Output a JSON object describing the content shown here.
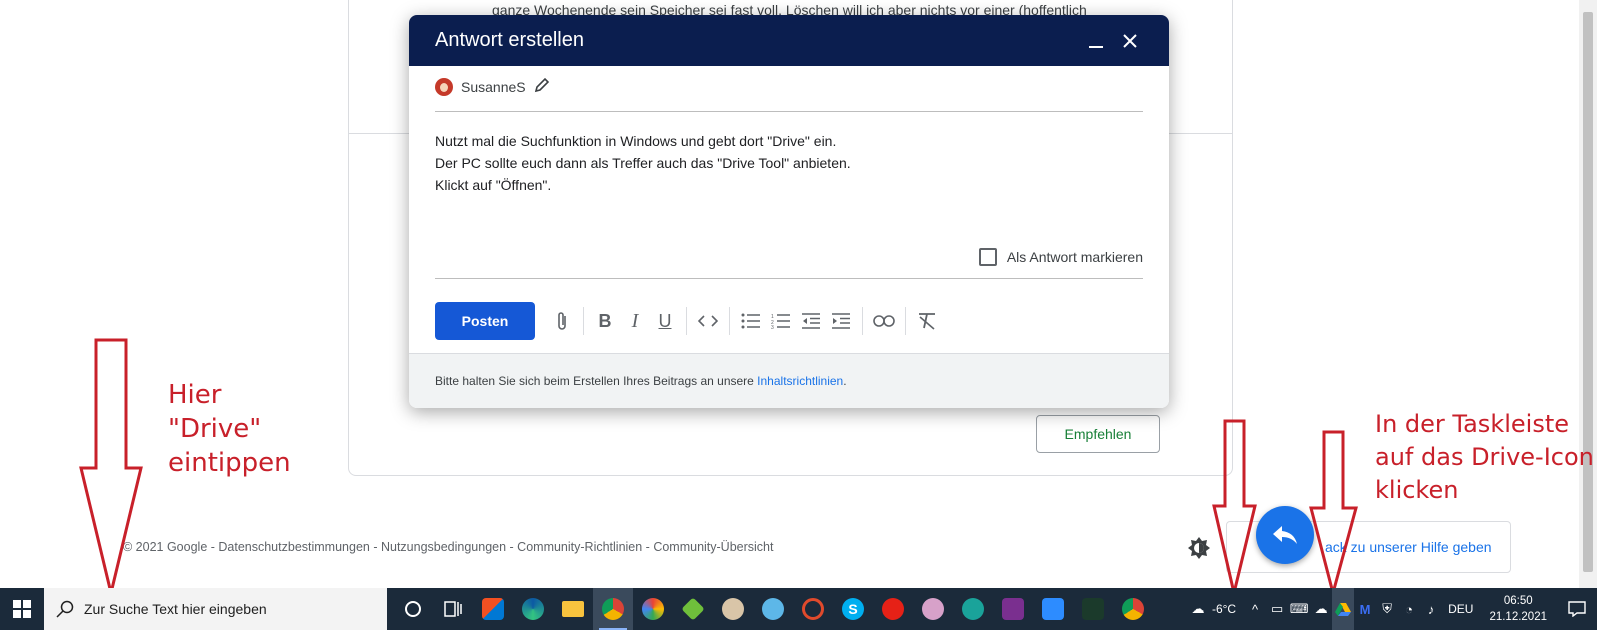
{
  "background": {
    "post_text_fragment": "ganze Wochenende sein Speicher sei fast voll. Löschen will ich aber nichts vor einer (hoffentlich",
    "recommend_label": "Empfehlen",
    "footer_text": "© 2021 Google - Datenschutzbestimmungen - Nutzungsbedingungen - Community-Richtlinien - Community-Übersicht",
    "feedback_label": "Feedback zu unserer Hilfe geben",
    "feedback_visible": "ack zu unserer Hilfe geben"
  },
  "dialog": {
    "title": "Antwort erstellen",
    "author": "SusanneS",
    "body_lines": [
      "Nutzt mal die Suchfunktion in Windows und gebt dort \"Drive\" ein.",
      "Der PC sollte euch dann als Treffer auch das \"Drive Tool\" anbieten.",
      "Klickt auf \"Öffnen\"."
    ],
    "mark_answer_label": "Als Antwort markieren",
    "post_button": "Posten",
    "footer_prefix": "Bitte halten Sie sich beim Erstellen Ihres Beitrags an unsere ",
    "footer_link": "Inhaltsrichtlinien",
    "footer_suffix": "."
  },
  "annotations": {
    "left_lines": [
      "Hier",
      "\"Drive\"",
      "eintippen"
    ],
    "right_lines": [
      "In der Taskleiste",
      "auf das Drive-Icon",
      "klicken"
    ],
    "color": "#c8202a"
  },
  "taskbar": {
    "search_placeholder": "Zur Suche Text hier eingeben",
    "weather": "-6°C",
    "language": "DEU",
    "time": "06:50",
    "date": "21.12.2021"
  },
  "colors": {
    "dialog_header": "#0b1e4f",
    "primary": "#1a73e8",
    "taskbar": "#1b2a3a"
  }
}
